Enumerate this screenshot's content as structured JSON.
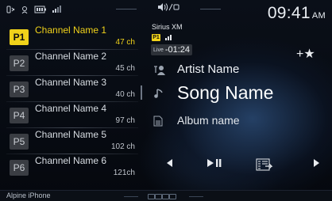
{
  "status": {
    "left_icons": [
      "phone-link-icon",
      "voice-icon",
      "battery-icon",
      "signal-bars-icon"
    ],
    "center_icons": [
      "speaker-icon",
      "settings-icon"
    ],
    "clock_time": "09:41",
    "clock_ampm": "AM"
  },
  "presets": [
    {
      "badge": "P1",
      "name": "Channel Name 1",
      "channel": "47 ch",
      "active": true
    },
    {
      "badge": "P2",
      "name": "Channel Name 2",
      "channel": "45 ch",
      "active": false
    },
    {
      "badge": "P3",
      "name": "Channel Name 3",
      "channel": "40 ch",
      "active": false
    },
    {
      "badge": "P4",
      "name": "Channel Name 4",
      "channel": "97 ch",
      "active": false
    },
    {
      "badge": "P5",
      "name": "Channel Name 5",
      "channel": "102 ch",
      "active": false
    },
    {
      "badge": "P6",
      "name": "Channel Name 6",
      "channel": "121ch",
      "active": false
    }
  ],
  "now_playing": {
    "source": "Sirius XM",
    "preset_badge": "P1",
    "live_label": "Live",
    "time_offset": "-01:24",
    "artist": "Artist Name",
    "song": "Song Name",
    "album": "Album name"
  },
  "controls": {
    "favorite": "+★"
  },
  "footer": {
    "device": "Alpine iPhone"
  },
  "colors": {
    "accent": "#f0d21a",
    "background": "#05080e"
  }
}
